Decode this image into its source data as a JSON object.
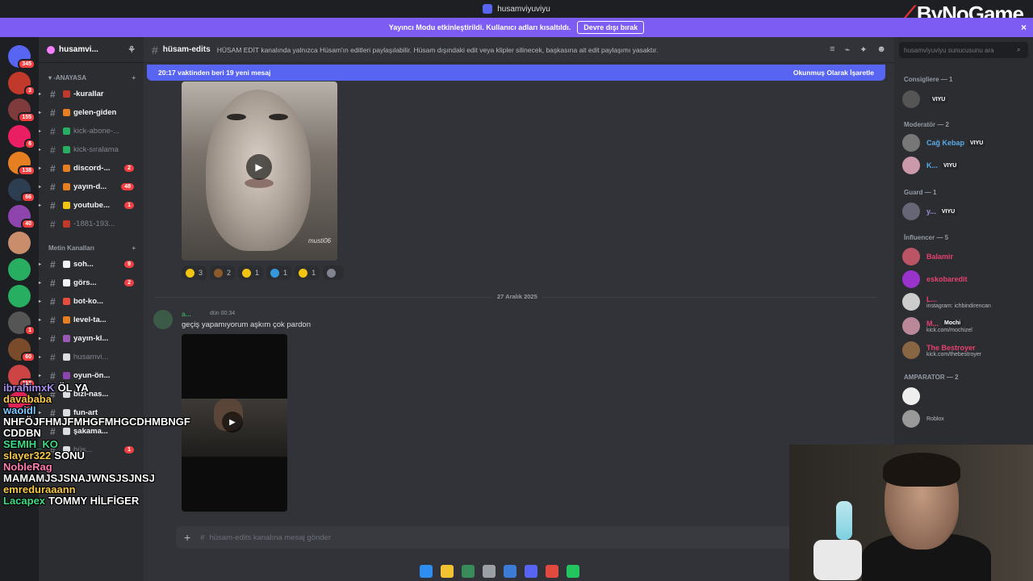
{
  "window": {
    "title": "husamviyuviyu"
  },
  "brand": {
    "text": "ByNoGame"
  },
  "banner": {
    "text": "Yayıncı Modu etkinleştirildi. Kullanıcı adları kısaltıldı.",
    "button": "Devre dışı bırak",
    "close": "×"
  },
  "servers": [
    {
      "badge": "345",
      "color": "#5865f2"
    },
    {
      "badge": "3",
      "color": "#c0392b"
    },
    {
      "badge": "155",
      "color": "#7f3b3b"
    },
    {
      "badge": "6",
      "color": "#e91e63"
    },
    {
      "badge": "138",
      "color": "#e67e22"
    },
    {
      "badge": "66",
      "color": "#2c3e50"
    },
    {
      "badge": "40",
      "color": "#8e44ad"
    },
    {
      "badge": "",
      "color": "#c98d6b"
    },
    {
      "badge": "",
      "color": "#27ae60"
    },
    {
      "badge": "",
      "color": "#27ae60"
    },
    {
      "badge": "1",
      "color": "#555"
    },
    {
      "badge": "60",
      "color": "#7a4b2b"
    },
    {
      "badge": "118",
      "color": "#c44"
    },
    {
      "badge": "26",
      "color": "#d25"
    }
  ],
  "guild": {
    "name": "husamvi...",
    "user_icon": "⚘"
  },
  "categories": {
    "anayasa": "ANAYASA",
    "text_channels": "Metin Kanalları"
  },
  "channels_a": [
    {
      "name": "-kurallar",
      "muted": false,
      "count": "",
      "emoji": "#c0392b",
      "arrow": "▸"
    },
    {
      "name": "gelen-giden",
      "muted": false,
      "count": "",
      "emoji": "#e67e22",
      "arrow": "▸"
    },
    {
      "name": "kick-abone-...",
      "muted": true,
      "count": "",
      "emoji": "#27ae60",
      "arrow": "▸"
    },
    {
      "name": "kick-sıralama",
      "muted": true,
      "count": "",
      "emoji": "#27ae60",
      "arrow": "▸"
    },
    {
      "name": "discord-...",
      "muted": false,
      "count": "2",
      "emoji": "#e67e22",
      "arrow": "▸"
    },
    {
      "name": "yayın-d...",
      "muted": false,
      "count": "48",
      "emoji": "#e67e22",
      "arrow": "▸"
    },
    {
      "name": "youtube...",
      "muted": false,
      "count": "1",
      "emoji": "#f1c40f",
      "arrow": "▸"
    },
    {
      "name": "-1881-193...",
      "muted": true,
      "count": "",
      "emoji": "#c0392b",
      "arrow": ""
    }
  ],
  "channels_b": [
    {
      "name": "soh...",
      "muted": false,
      "count": "9",
      "emoji": "#f2f3f5",
      "arrow": "▸"
    },
    {
      "name": "görs...",
      "muted": false,
      "count": "2",
      "emoji": "#f2f3f5",
      "arrow": "▸"
    },
    {
      "name": "bot-ko...",
      "muted": false,
      "count": "",
      "emoji": "#e74c3c",
      "arrow": "▸"
    },
    {
      "name": "level-ta...",
      "muted": false,
      "count": "",
      "emoji": "#e67e22",
      "arrow": "▸"
    },
    {
      "name": "yayın-kl...",
      "muted": false,
      "count": "",
      "emoji": "#9b59b6",
      "arrow": "▸"
    },
    {
      "name": "husamvi...",
      "muted": true,
      "count": "",
      "emoji": "#dbdee1",
      "arrow": "▸"
    },
    {
      "name": "oyun-ön...",
      "muted": false,
      "count": "",
      "emoji": "#8e44ad",
      "arrow": "▸"
    },
    {
      "name": "bizi-nas...",
      "muted": false,
      "count": "",
      "emoji": "#dbdee1",
      "arrow": "▸"
    },
    {
      "name": "fun-art",
      "muted": false,
      "count": "",
      "emoji": "#dbdee1",
      "arrow": "▸"
    },
    {
      "name": "şakama...",
      "muted": false,
      "count": "",
      "emoji": "#dbdee1",
      "arrow": "▸"
    },
    {
      "name": "hüs...",
      "muted": true,
      "count": "1",
      "emoji": "#dbdee1",
      "arrow": ""
    }
  ],
  "channel": {
    "name": "hüsam-edits",
    "topic": "HÜSAM EDİT kanalında yalnızca Hüsam'ın editleri paylaşılabilir. Hüsam dışındaki edit veya klipler silinecek, başkasına ait edit paylaşımı yasaktır."
  },
  "new_messages": {
    "text": "20:17 vaktinden beri 19 yeni mesaj",
    "action": "Okunmuş Olarak İşaretle"
  },
  "video1": {
    "watermark": "musti06"
  },
  "reactions": [
    {
      "count": "3",
      "color": "#f1c40f"
    },
    {
      "count": "2",
      "color": "#8b5a2b"
    },
    {
      "count": "1",
      "color": "#f1c40f"
    },
    {
      "count": "1",
      "color": "#3498db"
    },
    {
      "count": "1",
      "color": "#f1c40f"
    },
    {
      "count": "",
      "color": "#80848e"
    }
  ],
  "date_divider": "27 Aralık 2025",
  "message": {
    "author": "a...",
    "timestamp": "dün 00:34",
    "text": "geçiş yapamıyorum aşkım çok pardon"
  },
  "composer": {
    "placeholder": "hüsam-edits kanalına mesaj gönder"
  },
  "search": {
    "placeholder": "husamviyuviyu sunucusunu ara"
  },
  "roles": [
    {
      "label": "Consigliere — 1"
    },
    {
      "label": "Moderatör — 2"
    },
    {
      "label": "Guard — 1"
    },
    {
      "label": "İnfluencer — 5"
    },
    {
      "label": "AMPARATOR — 2"
    }
  ],
  "members": [
    {
      "name": "",
      "tag": "VIYU",
      "sub": "",
      "color": "#dbdee1",
      "avatar": "#555"
    },
    {
      "name": "Cağ Kebap",
      "tag": "VIYU",
      "sub": "",
      "color": "#5aa9e6",
      "avatar": "#777"
    },
    {
      "name": "K...",
      "tag": "VIYU",
      "sub": "",
      "color": "#5aa9e6",
      "avatar": "#c9a"
    },
    {
      "name": "y...",
      "tag": "VIYU",
      "sub": "",
      "color": "#a08bd8",
      "avatar": "#667"
    },
    {
      "name": "Balamir",
      "tag": "",
      "sub": "",
      "color": "#e8416f",
      "avatar": "#b56"
    },
    {
      "name": "eskobaredit",
      "tag": "",
      "sub": "",
      "color": "#e8416f",
      "avatar": "#93c"
    },
    {
      "name": "L...",
      "tag": "",
      "sub": "instagram: ichbindirencan",
      "color": "#e8416f",
      "avatar": "#ccc"
    },
    {
      "name": "M...",
      "tag": "Mochi",
      "sub": "kick.com/mochizel",
      "color": "#e8416f",
      "avatar": "#b89"
    },
    {
      "name": "The Bestroyer",
      "tag": "",
      "sub": "kick.com/thebestroyer",
      "color": "#e8416f",
      "avatar": "#864"
    },
    {
      "name": "",
      "tag": "",
      "sub": "",
      "color": "#dbdee1",
      "avatar": "#eee"
    },
    {
      "name": "",
      "tag": "",
      "sub": "Roblox",
      "color": "#dbdee1",
      "avatar": "#999"
    }
  ],
  "chat_overlay": [
    {
      "name": "ibrahimxK",
      "msg": "ÖL YA",
      "color": "#a98cf0"
    },
    {
      "name": "davababa",
      "msg": "",
      "color": "#f7c948"
    },
    {
      "name": "waoidl",
      "msg": "",
      "color": "#7ec8ff"
    },
    {
      "name": "",
      "msg": "NHFÖJFHMJFMHGFMHGCDHMBNGF",
      "color": "#ffffff"
    },
    {
      "name": "",
      "msg": "CDDBN",
      "color": "#ffffff"
    },
    {
      "name": "SEMIH_KO",
      "msg": "",
      "color": "#3ddc84"
    },
    {
      "name": "slayer322",
      "msg": "SONU",
      "color": "#f7c948"
    },
    {
      "name": "NobleRag",
      "msg": "",
      "color": "#ff7bb0"
    },
    {
      "name": "",
      "msg": "MAMAMJSJSNAJWNSJSJNSJ",
      "color": "#ffffff"
    },
    {
      "name": "emreduraaann",
      "msg": "",
      "color": "#f7c948"
    },
    {
      "name": "Lacapex",
      "msg": "TOMMY HİLFİGER",
      "color": "#3ddc84"
    }
  ],
  "taskbar": [
    {
      "color": "#2f8cf0"
    },
    {
      "color": "#f1c232"
    },
    {
      "color": "#3a8b5c"
    },
    {
      "color": "#9aa0a6"
    },
    {
      "color": "#3c7bd6"
    },
    {
      "color": "#5865f2"
    },
    {
      "color": "#e04a3f"
    },
    {
      "color": "#22c55e"
    }
  ]
}
